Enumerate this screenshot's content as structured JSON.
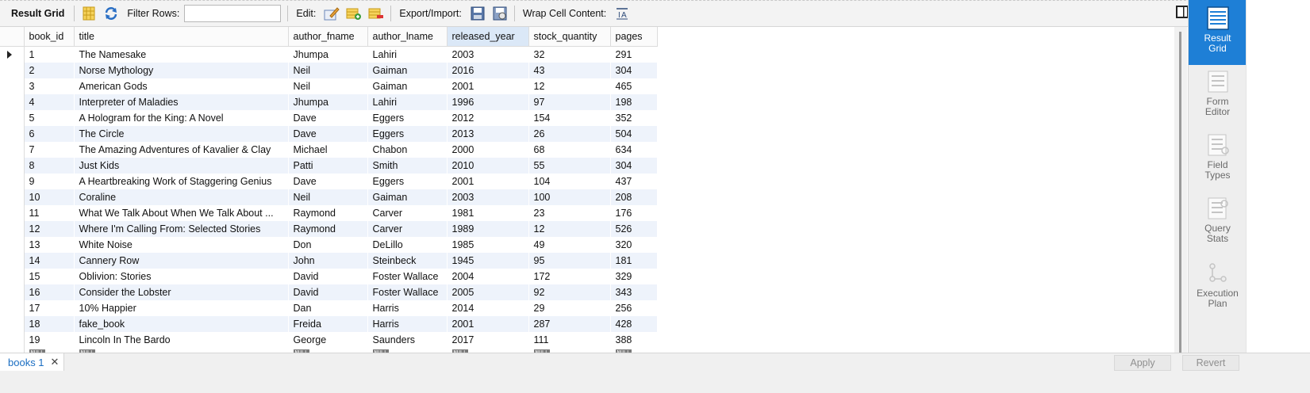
{
  "toolbar": {
    "title": "Result Grid",
    "filter_label": "Filter Rows:",
    "filter_value": "",
    "edit_label": "Edit:",
    "export_label": "Export/Import:",
    "wrap_label": "Wrap Cell Content:"
  },
  "grid": {
    "columns": [
      "book_id",
      "title",
      "author_fname",
      "author_lname",
      "released_year",
      "stock_quantity",
      "pages"
    ],
    "rows": [
      [
        "1",
        "The Namesake",
        "Jhumpa",
        "Lahiri",
        "2003",
        "32",
        "291"
      ],
      [
        "2",
        "Norse Mythology",
        "Neil",
        "Gaiman",
        "2016",
        "43",
        "304"
      ],
      [
        "3",
        "American Gods",
        "Neil",
        "Gaiman",
        "2001",
        "12",
        "465"
      ],
      [
        "4",
        "Interpreter of Maladies",
        "Jhumpa",
        "Lahiri",
        "1996",
        "97",
        "198"
      ],
      [
        "5",
        "A Hologram for the King: A Novel",
        "Dave",
        "Eggers",
        "2012",
        "154",
        "352"
      ],
      [
        "6",
        "The Circle",
        "Dave",
        "Eggers",
        "2013",
        "26",
        "504"
      ],
      [
        "7",
        "The Amazing Adventures of Kavalier & Clay",
        "Michael",
        "Chabon",
        "2000",
        "68",
        "634"
      ],
      [
        "8",
        "Just Kids",
        "Patti",
        "Smith",
        "2010",
        "55",
        "304"
      ],
      [
        "9",
        "A Heartbreaking Work of Staggering Genius",
        "Dave",
        "Eggers",
        "2001",
        "104",
        "437"
      ],
      [
        "10",
        "Coraline",
        "Neil",
        "Gaiman",
        "2003",
        "100",
        "208"
      ],
      [
        "11",
        "What We Talk About When We Talk About ...",
        "Raymond",
        "Carver",
        "1981",
        "23",
        "176"
      ],
      [
        "12",
        "Where I'm Calling From: Selected Stories",
        "Raymond",
        "Carver",
        "1989",
        "12",
        "526"
      ],
      [
        "13",
        "White Noise",
        "Don",
        "DeLillo",
        "1985",
        "49",
        "320"
      ],
      [
        "14",
        "Cannery Row",
        "John",
        "Steinbeck",
        "1945",
        "95",
        "181"
      ],
      [
        "15",
        "Oblivion: Stories",
        "David",
        "Foster Wallace",
        "2004",
        "172",
        "329"
      ],
      [
        "16",
        "Consider the Lobster",
        "David",
        "Foster Wallace",
        "2005",
        "92",
        "343"
      ],
      [
        "17",
        "10% Happier",
        "Dan",
        "Harris",
        "2014",
        "29",
        "256"
      ],
      [
        "18",
        "fake_book",
        "Freida",
        "Harris",
        "2001",
        "287",
        "428"
      ],
      [
        "19",
        "Lincoln In The Bardo",
        "George",
        "Saunders",
        "2017",
        "111",
        "388"
      ]
    ],
    "null_label": "NULL",
    "sorted_column": "released_year"
  },
  "side_panel": {
    "items": [
      {
        "label_1": "Result",
        "label_2": "Grid"
      },
      {
        "label_1": "Form",
        "label_2": "Editor"
      },
      {
        "label_1": "Field",
        "label_2": "Types"
      },
      {
        "label_1": "Query",
        "label_2": "Stats"
      },
      {
        "label_1": "Execution",
        "label_2": "Plan"
      }
    ]
  },
  "bottom": {
    "tab_label": "books 1",
    "close_glyph": "✕",
    "apply_label": "Apply",
    "revert_label": "Revert"
  },
  "colors": {
    "accent": "#1e7fd6",
    "alt_row": "#eef3fb",
    "sorted_header": "#dbe8f7"
  }
}
